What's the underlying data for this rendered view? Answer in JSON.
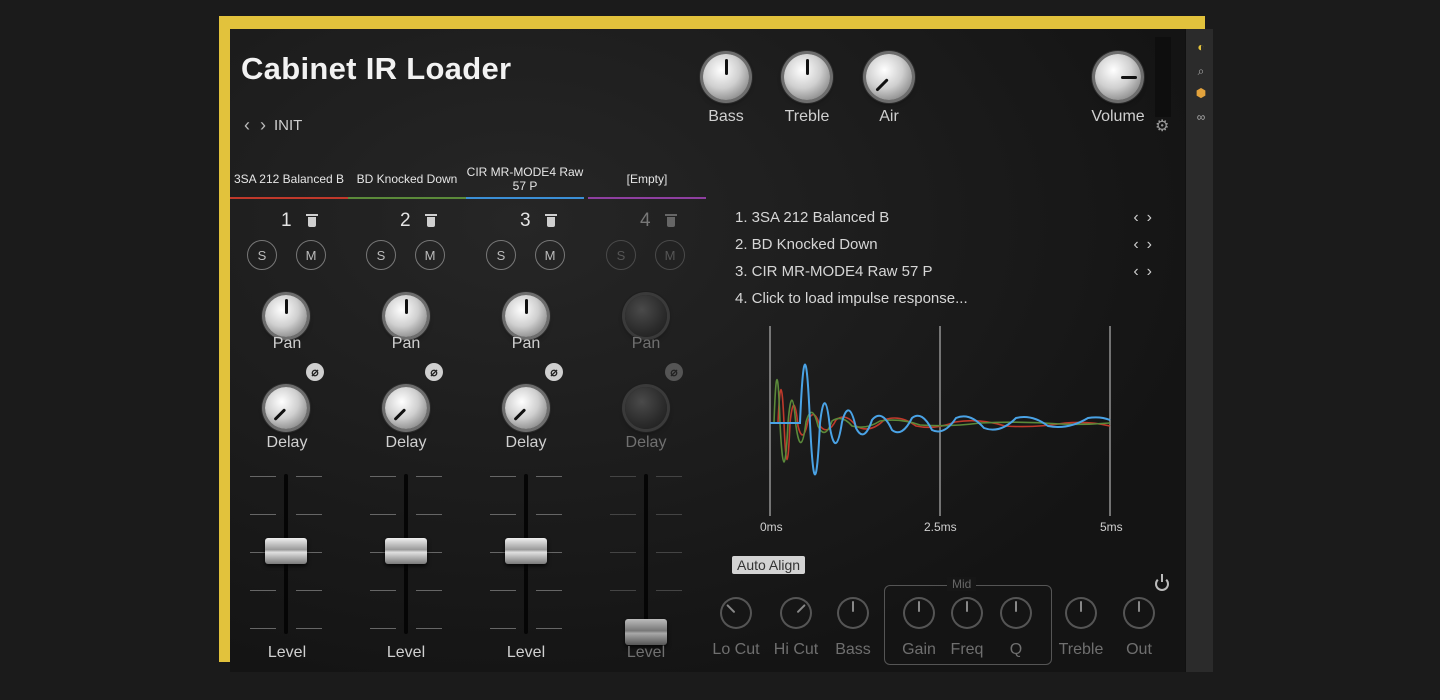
{
  "title": "Cabinet IR Loader",
  "preset": {
    "name": "INIT",
    "prev_icon": "chevron-left-icon",
    "next_icon": "chevron-right-icon"
  },
  "top_knobs": [
    {
      "label": "Bass"
    },
    {
      "label": "Treble"
    },
    {
      "label": "Air"
    },
    {
      "label": "Volume"
    }
  ],
  "channels": [
    {
      "header": "3SA 212 Balanced B",
      "number": "1",
      "color": "#c0392b",
      "solo": "S",
      "mute": "M",
      "pan": "Pan",
      "delay": "Delay",
      "level": "Level",
      "active": true
    },
    {
      "header": "BD Knocked Down",
      "number": "2",
      "color": "#5b8a3a",
      "solo": "S",
      "mute": "M",
      "pan": "Pan",
      "delay": "Delay",
      "level": "Level",
      "active": true
    },
    {
      "header": "CIR MR-MODE4 Raw 57 P",
      "number": "3",
      "color": "#3b8fd6",
      "solo": "S",
      "mute": "M",
      "pan": "Pan",
      "delay": "Delay",
      "level": "Level",
      "active": true
    },
    {
      "header": "[Empty]",
      "number": "4",
      "color": "#8e3fa0",
      "solo": "S",
      "mute": "M",
      "pan": "Pan",
      "delay": "Delay",
      "level": "Level",
      "active": false
    }
  ],
  "phase_symbol": "⌀",
  "ir_list": [
    {
      "text": "1. 3SA 212 Balanced B",
      "arrows": "‹›"
    },
    {
      "text": "2. BD Knocked Down",
      "arrows": "‹›"
    },
    {
      "text": "3. CIR MR-MODE4 Raw 57 P",
      "arrows": "‹›"
    },
    {
      "text": "4. Click to load impulse response...",
      "arrows": ""
    }
  ],
  "graph": {
    "x_ticks": [
      "0ms",
      "2.5ms",
      "5ms"
    ],
    "series_colors": [
      "#c0392b",
      "#5b8a3a",
      "#4aa3e6"
    ]
  },
  "auto_align": "Auto Align",
  "eq": {
    "mid_title": "Mid",
    "labels": [
      "Lo Cut",
      "Hi Cut",
      "Bass",
      "Gain",
      "Freq",
      "Q",
      "Treble",
      "Out"
    ]
  },
  "colors": {
    "frame": "#e2c23c",
    "background": "#1b1b1b"
  }
}
